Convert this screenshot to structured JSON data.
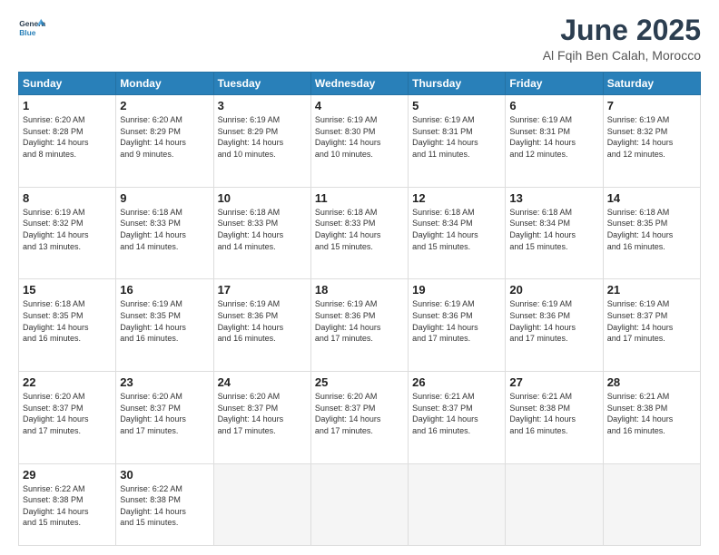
{
  "header": {
    "logo_line1": "General",
    "logo_line2": "Blue",
    "month": "June 2025",
    "location": "Al Fqih Ben Calah, Morocco"
  },
  "weekdays": [
    "Sunday",
    "Monday",
    "Tuesday",
    "Wednesday",
    "Thursday",
    "Friday",
    "Saturday"
  ],
  "weeks": [
    [
      {
        "day": 1,
        "sunrise": "6:20 AM",
        "sunset": "8:28 PM",
        "daylight": "14 hours and 8 minutes."
      },
      {
        "day": 2,
        "sunrise": "6:20 AM",
        "sunset": "8:29 PM",
        "daylight": "14 hours and 9 minutes."
      },
      {
        "day": 3,
        "sunrise": "6:19 AM",
        "sunset": "8:29 PM",
        "daylight": "14 hours and 10 minutes."
      },
      {
        "day": 4,
        "sunrise": "6:19 AM",
        "sunset": "8:30 PM",
        "daylight": "14 hours and 10 minutes."
      },
      {
        "day": 5,
        "sunrise": "6:19 AM",
        "sunset": "8:31 PM",
        "daylight": "14 hours and 11 minutes."
      },
      {
        "day": 6,
        "sunrise": "6:19 AM",
        "sunset": "8:31 PM",
        "daylight": "14 hours and 12 minutes."
      },
      {
        "day": 7,
        "sunrise": "6:19 AM",
        "sunset": "8:32 PM",
        "daylight": "14 hours and 12 minutes."
      }
    ],
    [
      {
        "day": 8,
        "sunrise": "6:19 AM",
        "sunset": "8:32 PM",
        "daylight": "14 hours and 13 minutes."
      },
      {
        "day": 9,
        "sunrise": "6:18 AM",
        "sunset": "8:33 PM",
        "daylight": "14 hours and 14 minutes."
      },
      {
        "day": 10,
        "sunrise": "6:18 AM",
        "sunset": "8:33 PM",
        "daylight": "14 hours and 14 minutes."
      },
      {
        "day": 11,
        "sunrise": "6:18 AM",
        "sunset": "8:33 PM",
        "daylight": "14 hours and 15 minutes."
      },
      {
        "day": 12,
        "sunrise": "6:18 AM",
        "sunset": "8:34 PM",
        "daylight": "14 hours and 15 minutes."
      },
      {
        "day": 13,
        "sunrise": "6:18 AM",
        "sunset": "8:34 PM",
        "daylight": "14 hours and 15 minutes."
      },
      {
        "day": 14,
        "sunrise": "6:18 AM",
        "sunset": "8:35 PM",
        "daylight": "14 hours and 16 minutes."
      }
    ],
    [
      {
        "day": 15,
        "sunrise": "6:18 AM",
        "sunset": "8:35 PM",
        "daylight": "14 hours and 16 minutes."
      },
      {
        "day": 16,
        "sunrise": "6:19 AM",
        "sunset": "8:35 PM",
        "daylight": "14 hours and 16 minutes."
      },
      {
        "day": 17,
        "sunrise": "6:19 AM",
        "sunset": "8:36 PM",
        "daylight": "14 hours and 16 minutes."
      },
      {
        "day": 18,
        "sunrise": "6:19 AM",
        "sunset": "8:36 PM",
        "daylight": "14 hours and 17 minutes."
      },
      {
        "day": 19,
        "sunrise": "6:19 AM",
        "sunset": "8:36 PM",
        "daylight": "14 hours and 17 minutes."
      },
      {
        "day": 20,
        "sunrise": "6:19 AM",
        "sunset": "8:36 PM",
        "daylight": "14 hours and 17 minutes."
      },
      {
        "day": 21,
        "sunrise": "6:19 AM",
        "sunset": "8:37 PM",
        "daylight": "14 hours and 17 minutes."
      }
    ],
    [
      {
        "day": 22,
        "sunrise": "6:20 AM",
        "sunset": "8:37 PM",
        "daylight": "14 hours and 17 minutes."
      },
      {
        "day": 23,
        "sunrise": "6:20 AM",
        "sunset": "8:37 PM",
        "daylight": "14 hours and 17 minutes."
      },
      {
        "day": 24,
        "sunrise": "6:20 AM",
        "sunset": "8:37 PM",
        "daylight": "14 hours and 17 minutes."
      },
      {
        "day": 25,
        "sunrise": "6:20 AM",
        "sunset": "8:37 PM",
        "daylight": "14 hours and 17 minutes."
      },
      {
        "day": 26,
        "sunrise": "6:21 AM",
        "sunset": "8:37 PM",
        "daylight": "14 hours and 16 minutes."
      },
      {
        "day": 27,
        "sunrise": "6:21 AM",
        "sunset": "8:38 PM",
        "daylight": "14 hours and 16 minutes."
      },
      {
        "day": 28,
        "sunrise": "6:21 AM",
        "sunset": "8:38 PM",
        "daylight": "14 hours and 16 minutes."
      }
    ],
    [
      {
        "day": 29,
        "sunrise": "6:22 AM",
        "sunset": "8:38 PM",
        "daylight": "14 hours and 15 minutes."
      },
      {
        "day": 30,
        "sunrise": "6:22 AM",
        "sunset": "8:38 PM",
        "daylight": "14 hours and 15 minutes."
      },
      null,
      null,
      null,
      null,
      null
    ]
  ],
  "labels": {
    "sunrise": "Sunrise:",
    "sunset": "Sunset:",
    "daylight": "Daylight:"
  }
}
